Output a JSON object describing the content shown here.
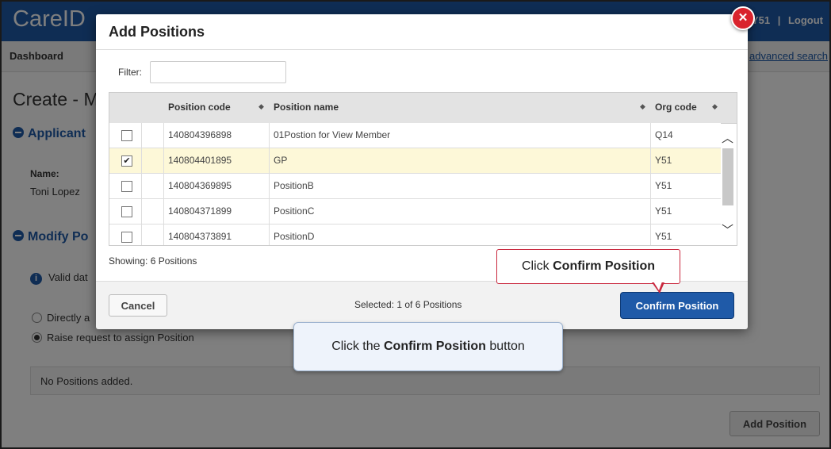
{
  "app": {
    "brand": "CareID",
    "user_code": "Y51",
    "separator": "|",
    "logout": "Logout",
    "nav_dashboard": "Dashboard",
    "nav_advanced_search": "advanced search"
  },
  "page": {
    "title": "Create - M",
    "section_applicant": "Applicant",
    "name_label": "Name:",
    "name_value": "Toni Lopez",
    "section_modify": "Modify Po",
    "info_text": "Valid dat",
    "radio_direct": "Directly a",
    "radio_raise": "Raise request to assign Position",
    "no_positions": "No Positions added.",
    "add_position_button": "Add Position"
  },
  "modal": {
    "title": "Add Positions",
    "filter_label": "Filter:",
    "filter_value": "",
    "columns": [
      "Position code",
      "Position name",
      "Org code"
    ],
    "rows": [
      {
        "checked": false,
        "code": "140804396898",
        "name": "01Postion for View Member",
        "org": "Q14"
      },
      {
        "checked": true,
        "code": "140804401895",
        "name": "GP",
        "org": "Y51"
      },
      {
        "checked": false,
        "code": "140804369895",
        "name": "PositionB",
        "org": "Y51"
      },
      {
        "checked": false,
        "code": "140804371899",
        "name": "PositionC",
        "org": "Y51"
      },
      {
        "checked": false,
        "code": "140804373891",
        "name": "PositionD",
        "org": "Y51"
      }
    ],
    "showing": "Showing: 6 Positions",
    "cancel": "Cancel",
    "selected": "Selected: 1 of 6 Positions",
    "confirm": "Confirm Position"
  },
  "callouts": {
    "top_prefix": "Click ",
    "top_bold": "Confirm Position",
    "bottom_prefix": "Click the ",
    "bottom_bold": "Confirm Position",
    "bottom_suffix": " button"
  },
  "icons": {
    "close": "close-icon",
    "sort": "sort-icon",
    "collapse": "collapse-icon",
    "info": "info-icon"
  },
  "colors": {
    "brand_blue": "#1f5aa8",
    "close_red": "#d9232d",
    "selected_row": "#fdf8d8",
    "callout_border": "#c9283e"
  }
}
